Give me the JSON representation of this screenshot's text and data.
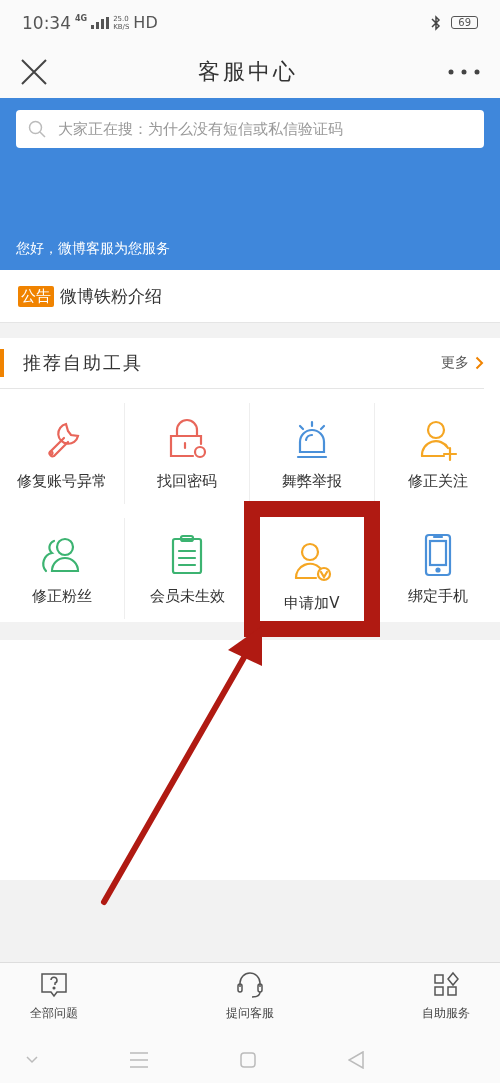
{
  "status_bar": {
    "time": "10:34",
    "network": "4G",
    "speed": "25.0",
    "speed_unit": "KB/S",
    "hd": "HD",
    "battery": "69"
  },
  "header": {
    "title": "客服中心"
  },
  "banner": {
    "search": {
      "placeholder": "大家正在搜：为什么没有短信或私信验证码"
    },
    "greeting": "您好，微博客服为您服务"
  },
  "notice": {
    "tag": "公告",
    "text": "微博铁粉介绍"
  },
  "tools": {
    "title": "推荐自助工具",
    "more": "更多",
    "items": [
      {
        "label": "修复账号异常",
        "kind": "wrench",
        "color": "#e8665a",
        "highlighted": false
      },
      {
        "label": "找回密码",
        "kind": "lock",
        "color": "#e8665a",
        "highlighted": false
      },
      {
        "label": "舞弊举报",
        "kind": "alarm",
        "color": "#4a90d9",
        "highlighted": false
      },
      {
        "label": "修正关注",
        "kind": "person-plus",
        "color": "#f5a623",
        "highlighted": false
      },
      {
        "label": "修正粉丝",
        "kind": "people",
        "color": "#3cb371",
        "highlighted": false
      },
      {
        "label": "会员未生效",
        "kind": "clipboard",
        "color": "#3cb371",
        "highlighted": false
      },
      {
        "label": "申请加V",
        "kind": "person-check",
        "color": "#f5a623",
        "highlighted": true
      },
      {
        "label": "绑定手机",
        "kind": "phone",
        "color": "#4a90d9",
        "highlighted": false
      }
    ]
  },
  "bottom_tabs": [
    {
      "label": "全部问题",
      "kind": "question"
    },
    {
      "label": "提问客服",
      "kind": "headset"
    },
    {
      "label": "自助服务",
      "kind": "grid"
    }
  ]
}
